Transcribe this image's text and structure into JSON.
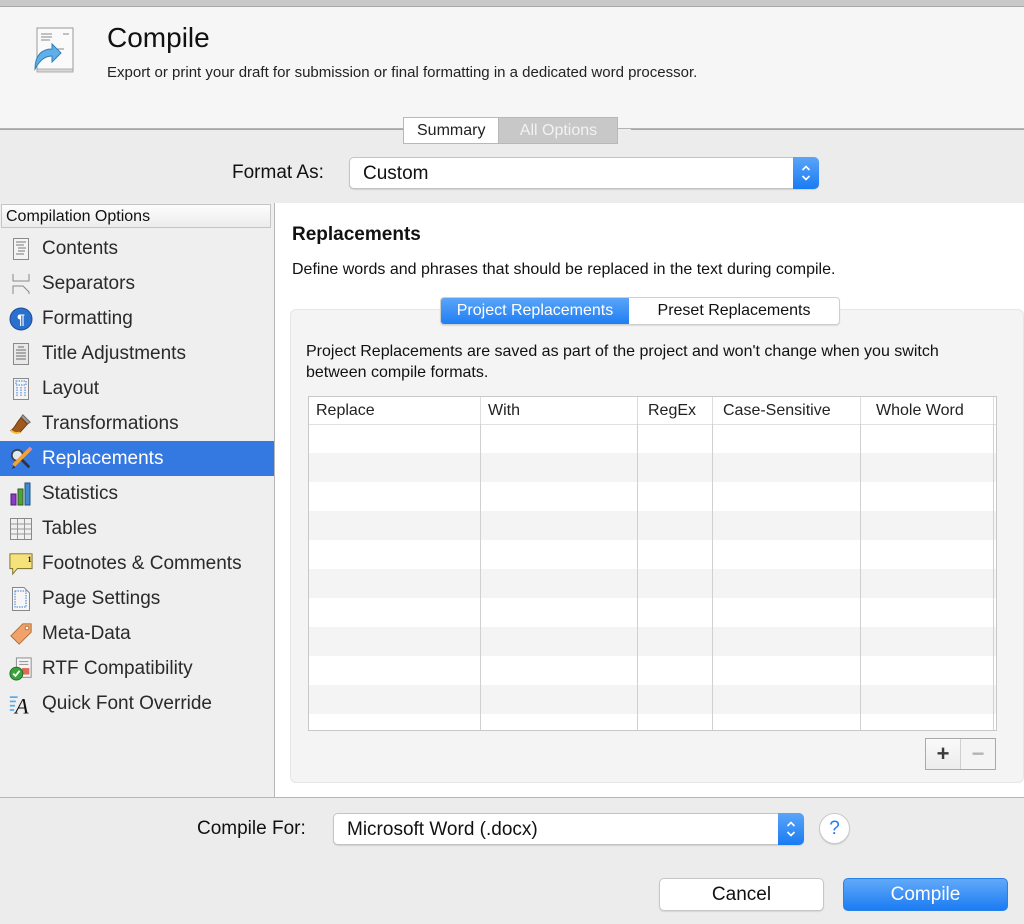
{
  "header": {
    "title": "Compile",
    "subtitle": "Export or print your draft for submission or final formatting in a dedicated word processor."
  },
  "mode_tabs": [
    {
      "label": "Summary",
      "active": true
    },
    {
      "label": "All Options",
      "active": false
    }
  ],
  "format_as": {
    "label": "Format As:",
    "value": "Custom"
  },
  "sidebar": {
    "header": "Compilation Options",
    "selected": "Replacements",
    "items": [
      {
        "label": "Contents",
        "icon": "contents-list-icon"
      },
      {
        "label": "Separators",
        "icon": "separators-icon"
      },
      {
        "label": "Formatting",
        "icon": "pilcrow-icon"
      },
      {
        "label": "Title Adjustments",
        "icon": "title-adjustments-icon"
      },
      {
        "label": "Layout",
        "icon": "layout-icon"
      },
      {
        "label": "Transformations",
        "icon": "brush-icon"
      },
      {
        "label": "Replacements",
        "icon": "magnifier-pencil-icon"
      },
      {
        "label": "Statistics",
        "icon": "bar-chart-icon"
      },
      {
        "label": "Tables",
        "icon": "table-grid-icon"
      },
      {
        "label": "Footnotes & Comments",
        "icon": "footnote-bubble-icon"
      },
      {
        "label": "Page Settings",
        "icon": "page-settings-icon"
      },
      {
        "label": "Meta-Data",
        "icon": "tag-icon"
      },
      {
        "label": "RTF Compatibility",
        "icon": "rtf-check-icon"
      },
      {
        "label": "Quick Font Override",
        "icon": "font-override-icon"
      }
    ]
  },
  "main": {
    "title": "Replacements",
    "description": "Define words and phrases that should be replaced in the text during compile.",
    "tabs": [
      {
        "label": "Project Replacements",
        "active": true
      },
      {
        "label": "Preset Replacements",
        "active": false
      }
    ],
    "note": "Project Replacements are saved as part of the project and won't change when you switch between compile formats.",
    "table": {
      "columns": [
        "Replace",
        "With",
        "RegEx",
        "Case-Sensitive",
        "Whole Word"
      ],
      "rows": []
    },
    "add_label": "+",
    "remove_label": "−"
  },
  "compile_for": {
    "label": "Compile For:",
    "value": "Microsoft Word (.docx)",
    "help_label": "?"
  },
  "footer": {
    "cancel_label": "Cancel",
    "compile_label": "Compile"
  },
  "colors": {
    "accent": "#1f7ef3",
    "selection": "#3478e2"
  }
}
